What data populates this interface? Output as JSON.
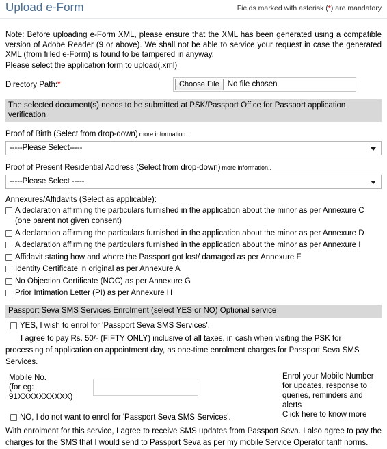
{
  "header": {
    "title": "Upload e-Form",
    "mandatory_prefix": "Fields marked with asterisk (",
    "mandatory_star": "*",
    "mandatory_suffix": ") are mandatory"
  },
  "note": {
    "paragraph": "Note: Before uploading e-Form XML, please ensure that the XML has been generated using a compatible version of Adobe Reader (9 or above). We shall not be able to service your request in case the generated XML (from filled e-Form) is found to be tampered in anyway.",
    "instruction": "Please select the application form to upload(.xml)"
  },
  "directory": {
    "label": "Directory Path:",
    "required_star": "*",
    "choose_file_label": "Choose File",
    "file_status": "No file chosen"
  },
  "document_bar": "The selected document(s) needs to be submitted at PSK/Passport Office for Passport application verification",
  "proof_of_birth": {
    "label": "Proof of Birth (Select from drop-down)",
    "more_info": "more information..",
    "selected": "-----Please Select-----"
  },
  "proof_of_address": {
    "label": "Proof of Present Residential Address (Select from drop-down)",
    "more_info": "more information..",
    "selected": "-----Please Select -----"
  },
  "annexures": {
    "heading": "Annexures/Affidavits (Select as applicable):",
    "items": [
      "A declaration affirming the particulars furnished in the application about the minor as per Annexure C (one parent not given consent)",
      "A declaration affirming the particulars furnished in the application about the minor as per Annexure D",
      "A declaration affirming the particulars furnished in the application about the minor as per Annexure I",
      "Affidavit stating how and where the Passport got lost/ damaged as per Annexure F",
      "Identity Certificate in original as per Annexure A",
      "No Objection Certificate (NOC) as per Annexure G",
      "Prior Intimation Letter (PI) as per Annexure H"
    ]
  },
  "sms": {
    "bar": "Passport Seva SMS Services Enrolment (select YES or NO)  Optional service",
    "yes_label": "YES, I wish to enrol for 'Passport Seva SMS Services'.",
    "agree_text": "I agree to pay Rs. 50/- (FIFTY ONLY) inclusive of all taxes, in cash when visiting the PSK for processing of application on appointment day, as one-time enrolment charges for Passport Seva SMS Services.",
    "mobile_label_line1": "Mobile No.",
    "mobile_label_line2": "(for eg:",
    "mobile_label_line3": "91XXXXXXXXXX)",
    "mobile_value": "",
    "help_line1": "Enrol your Mobile Number",
    "help_line2": "for updates, response to",
    "help_line3": "queries, reminders and alerts",
    "help_line4": "Click here to know more",
    "no_label": "NO, I do not want to enrol for 'Passport Seva SMS Services'.",
    "footer_text": "With enrolment for this service, I agree to receive SMS updates from Passport Seva. I also agree to pay the charges for the SMS that I would send to Passport Seva as per my mobile Service Operator tariff norms."
  },
  "colors": {
    "title": "#4a6f94",
    "required": "#c00000",
    "section_bar": "#d8d8d8"
  }
}
